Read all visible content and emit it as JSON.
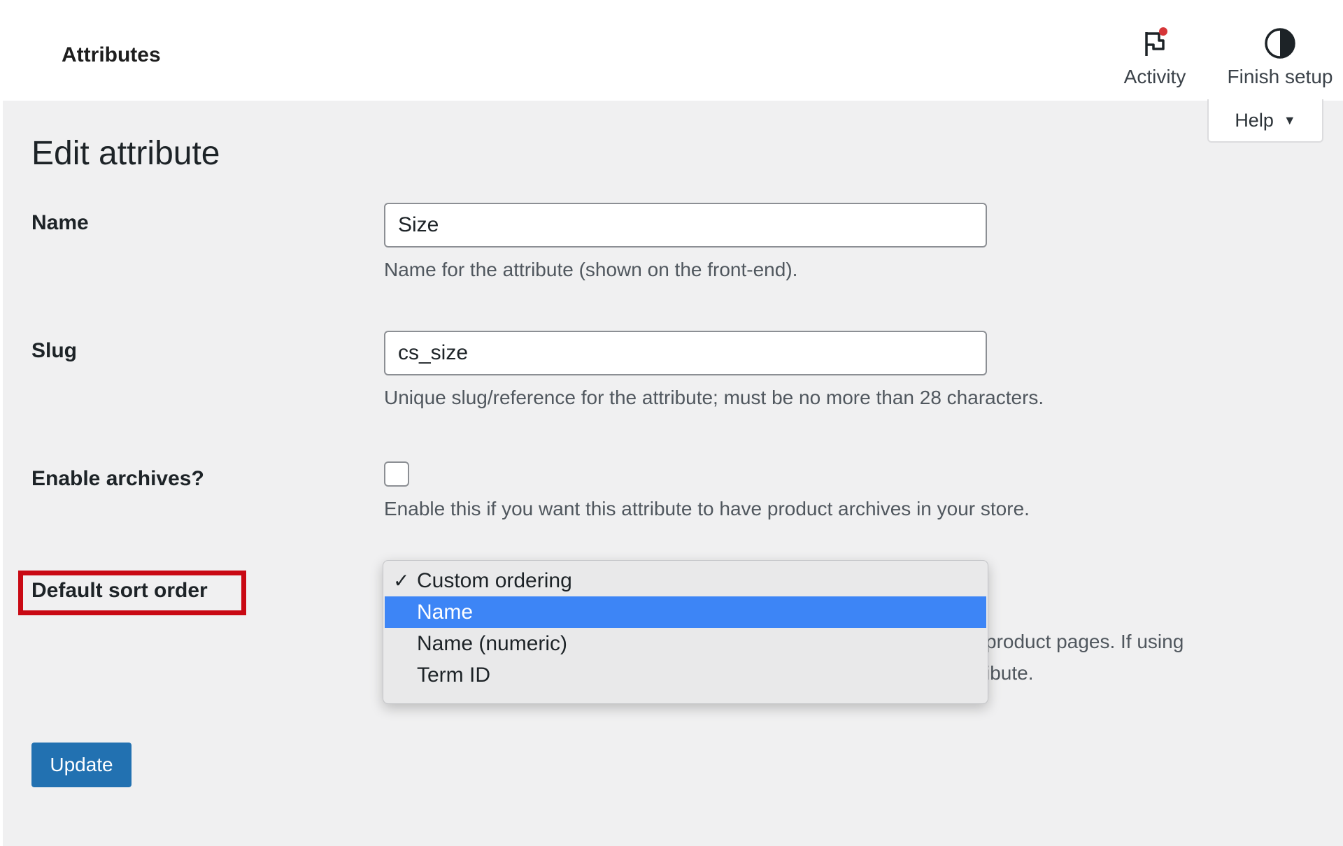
{
  "topbar": {
    "title": "Attributes",
    "activity_label": "Activity",
    "finish_setup_label": "Finish setup"
  },
  "help": {
    "label": "Help"
  },
  "heading": "Edit attribute",
  "fields": {
    "name": {
      "label": "Name",
      "value": "Size",
      "description": "Name for the attribute (shown on the front-end)."
    },
    "slug": {
      "label": "Slug",
      "value": "cs_size",
      "description": "Unique slug/reference for the attribute; must be no more than 28 characters."
    },
    "archives": {
      "label": "Enable archives?",
      "checked": false,
      "description": "Enable this if you want this attribute to have product archives in your store."
    },
    "sort_order": {
      "label": "Default sort order",
      "description_line1_visible": "product pages. If using",
      "description_line2_visible": "ibute.",
      "options": [
        {
          "label": "Custom ordering",
          "checked": true
        },
        {
          "label": "Name",
          "highlighted": true
        },
        {
          "label": "Name (numeric)"
        },
        {
          "label": "Term ID"
        }
      ]
    }
  },
  "actions": {
    "update_label": "Update"
  },
  "colors": {
    "primary": "#2271b1",
    "dropdown_highlight": "#3d85f6",
    "annotation_red": "#c90914",
    "notification_dot": "#d63638"
  },
  "icons": {
    "activity": "flag-icon",
    "finish_setup": "half-circle-icon",
    "help_caret": "caret-down-icon",
    "checkmark": "check-icon"
  }
}
